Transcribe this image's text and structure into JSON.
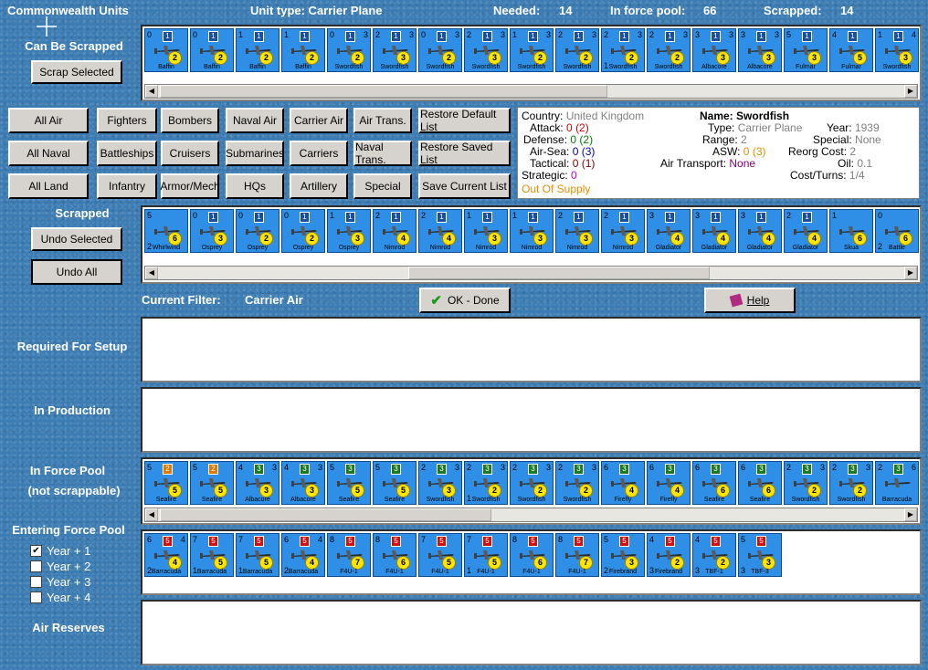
{
  "header": {
    "title": "Commonwealth Units",
    "unit_type": "Unit type: Carrier Plane",
    "needed_label": "Needed:",
    "needed_value": "14",
    "force_pool_label": "In force pool:",
    "force_pool_value": "66",
    "scrapped_label": "Scrapped:",
    "scrapped_value": "14"
  },
  "can_be_scrapped": {
    "label": "Can Be Scrapped",
    "button": "Scrap Selected",
    "units": [
      {
        "tl": "0",
        "flag": "1",
        "tr": "",
        "yc": "2",
        "name": "Baffin",
        "bl": ""
      },
      {
        "tl": "0",
        "flag": "1",
        "tr": "",
        "yc": "2",
        "name": "Baffin",
        "bl": ""
      },
      {
        "tl": "1",
        "flag": "1",
        "tr": "",
        "yc": "2",
        "name": "Baffin",
        "bl": ""
      },
      {
        "tl": "1",
        "flag": "1",
        "tr": "",
        "yc": "2",
        "name": "Baffin",
        "bl": ""
      },
      {
        "tl": "0",
        "flag": "1",
        "tr": "3",
        "yc": "2",
        "name": "Swordfish",
        "bl": ""
      },
      {
        "tl": "2",
        "flag": "1",
        "tr": "3",
        "yc": "3",
        "name": "Swordfish",
        "bl": ""
      },
      {
        "tl": "0",
        "flag": "1",
        "tr": "3",
        "yc": "2",
        "name": "Swordfish",
        "bl": ""
      },
      {
        "tl": "2",
        "flag": "1",
        "tr": "3",
        "yc": "3",
        "name": "Swordfish",
        "bl": ""
      },
      {
        "tl": "1",
        "flag": "1",
        "tr": "3",
        "yc": "2",
        "name": "Swordfish",
        "bl": ""
      },
      {
        "tl": "2",
        "flag": "1",
        "tr": "3",
        "yc": "2",
        "name": "Swordfish",
        "bl": ""
      },
      {
        "tl": "2",
        "flag": "1",
        "tr": "3",
        "yc": "2",
        "name": "Swordfish",
        "bl": "1"
      },
      {
        "tl": "2",
        "flag": "1",
        "tr": "3",
        "yc": "2",
        "name": "Swordfish",
        "bl": ""
      },
      {
        "tl": "3",
        "flag": "1",
        "tr": "3",
        "yc": "3",
        "name": "Albacore",
        "bl": ""
      },
      {
        "tl": "3",
        "flag": "1",
        "tr": "3",
        "yc": "3",
        "name": "Albacore",
        "bl": ""
      },
      {
        "tl": "5",
        "flag": "1",
        "tr": "",
        "yc": "3",
        "name": "Fulmar",
        "bl": ""
      },
      {
        "tl": "4",
        "flag": "1",
        "tr": "",
        "yc": "5",
        "name": "Fulmar",
        "bl": ""
      },
      {
        "tl": "1",
        "flag": "1",
        "tr": "4",
        "yc": "3",
        "name": "Swordfish",
        "bl": ""
      }
    ]
  },
  "filter_buttons": {
    "row1": [
      "All Air",
      "Fighters",
      "Bombers",
      "Naval Air",
      "Carrier Air",
      "Air Trans.",
      "Restore Default List"
    ],
    "row2": [
      "All Naval",
      "Battleships",
      "Cruisers",
      "Submarines",
      "Carriers",
      "Naval Trans.",
      "Restore Saved List"
    ],
    "row3": [
      "All Land",
      "Infantry",
      "Armor/Mech",
      "HQs",
      "Artillery",
      "Special",
      "Save Current List"
    ]
  },
  "info": {
    "country_label": "Country:",
    "country": "United Kingdom",
    "attack_label": "Attack:",
    "attack": "0",
    "attack_b": "(2)",
    "defense_label": "Defense:",
    "defense": "0",
    "defense_b": "(2)",
    "airsea_label": "Air-Sea:",
    "airsea": "0",
    "airsea_b": "(3)",
    "tactical_label": "Tactical:",
    "tactical": "0",
    "tactical_b": "(1)",
    "strategic_label": "Strategic:",
    "strategic": "0",
    "supply": "Out Of Supply",
    "name_label": "Name:",
    "name": "Swordfish",
    "type_label": "Type:",
    "type": "Carrier Plane",
    "year_label": "Year:",
    "year": "1939",
    "range_label": "Range:",
    "range": "2",
    "special_label": "Special:",
    "special": "None",
    "asw_label": "ASW:",
    "asw": "0",
    "asw_b": "(3)",
    "reorg_label": "Reorg Cost:",
    "reorg": "2",
    "airtrans_label": "Air Transport:",
    "airtrans": "None",
    "oil_label": "Oil:",
    "oil": "0.1",
    "cost_label": "Cost/Turns:",
    "cost": "1/4"
  },
  "scrapped": {
    "label": "Scrapped",
    "undo_selected": "Undo Selected",
    "undo_all": "Undo All",
    "units": [
      {
        "tl": "5",
        "flag": "",
        "tr": "",
        "yc": "6",
        "name": "Whirlwind",
        "bl": "2"
      },
      {
        "tl": "0",
        "flag": "1",
        "tr": "",
        "yc": "3",
        "name": "Osprey",
        "bl": ""
      },
      {
        "tl": "0",
        "flag": "1",
        "tr": "",
        "yc": "2",
        "name": "Osprey",
        "bl": ""
      },
      {
        "tl": "0",
        "flag": "1",
        "tr": "",
        "yc": "2",
        "name": "Osprey",
        "bl": ""
      },
      {
        "tl": "1",
        "flag": "1",
        "tr": "",
        "yc": "3",
        "name": "Osprey",
        "bl": ""
      },
      {
        "tl": "2",
        "flag": "1",
        "tr": "",
        "yc": "4",
        "name": "Nimrod",
        "bl": ""
      },
      {
        "tl": "2",
        "flag": "1",
        "tr": "",
        "yc": "4",
        "name": "Nimrod",
        "bl": ""
      },
      {
        "tl": "1",
        "flag": "1",
        "tr": "",
        "yc": "3",
        "name": "Nimrod",
        "bl": ""
      },
      {
        "tl": "1",
        "flag": "1",
        "tr": "",
        "yc": "3",
        "name": "Nimrod",
        "bl": ""
      },
      {
        "tl": "2",
        "flag": "1",
        "tr": "",
        "yc": "3",
        "name": "Nimrod",
        "bl": ""
      },
      {
        "tl": "2",
        "flag": "1",
        "tr": "",
        "yc": "3",
        "name": "Nimrod",
        "bl": ""
      },
      {
        "tl": "3",
        "flag": "1",
        "tr": "",
        "yc": "4",
        "name": "Gladiator",
        "bl": ""
      },
      {
        "tl": "3",
        "flag": "1",
        "tr": "",
        "yc": "4",
        "name": "Gladiator",
        "bl": ""
      },
      {
        "tl": "3",
        "flag": "1",
        "tr": "",
        "yc": "4",
        "name": "Gladiator",
        "bl": ""
      },
      {
        "tl": "2",
        "flag": "1",
        "tr": "",
        "yc": "4",
        "name": "Gladiator",
        "bl": ""
      },
      {
        "tl": "1",
        "flag": "",
        "tr": "",
        "yc": "6",
        "name": "Skua",
        "bl": ""
      },
      {
        "tl": "0",
        "flag": "",
        "tr": "",
        "yc": "6",
        "name": "Battle",
        "bl": "2"
      }
    ]
  },
  "filter": {
    "label": "Current Filter:",
    "value": "Carrier Air",
    "ok_button": "OK - Done",
    "help_button": "Help"
  },
  "required_for_setup": {
    "label": "Required For Setup"
  },
  "in_production": {
    "label": "In Production"
  },
  "in_force_pool": {
    "label_line1": "In Force Pool",
    "label_line2": "(not scrappable)",
    "units": [
      {
        "tl": "5",
        "flag": "2",
        "tr": "",
        "yc": "5",
        "name": "Seafire",
        "bl": ""
      },
      {
        "tl": "5",
        "flag": "2",
        "tr": "",
        "yc": "5",
        "name": "Seafire",
        "bl": ""
      },
      {
        "tl": "4",
        "flag": "3",
        "tr": "3",
        "yc": "3",
        "name": "Albacore",
        "bl": ""
      },
      {
        "tl": "4",
        "flag": "3",
        "tr": "3",
        "yc": "3",
        "name": "Albacore",
        "bl": ""
      },
      {
        "tl": "5",
        "flag": "3",
        "tr": "",
        "yc": "5",
        "name": "Seafire",
        "bl": ""
      },
      {
        "tl": "5",
        "flag": "3",
        "tr": "",
        "yc": "5",
        "name": "Seafire",
        "bl": ""
      },
      {
        "tl": "2",
        "flag": "3",
        "tr": "3",
        "yc": "3",
        "name": "Swordfish",
        "bl": ""
      },
      {
        "tl": "2",
        "flag": "3",
        "tr": "3",
        "yc": "2",
        "name": "Swordfish",
        "bl": "1"
      },
      {
        "tl": "2",
        "flag": "3",
        "tr": "3",
        "yc": "2",
        "name": "Swordfish",
        "bl": ""
      },
      {
        "tl": "2",
        "flag": "3",
        "tr": "3",
        "yc": "2",
        "name": "Swordfish",
        "bl": ""
      },
      {
        "tl": "6",
        "flag": "3",
        "tr": "",
        "yc": "4",
        "name": "Firefly",
        "bl": ""
      },
      {
        "tl": "6",
        "flag": "3",
        "tr": "",
        "yc": "4",
        "name": "Firefly",
        "bl": ""
      },
      {
        "tl": "6",
        "flag": "3",
        "tr": "",
        "yc": "6",
        "name": "Seafire",
        "bl": ""
      },
      {
        "tl": "6",
        "flag": "3",
        "tr": "",
        "yc": "6",
        "name": "Seafire",
        "bl": ""
      },
      {
        "tl": "2",
        "flag": "3",
        "tr": "3",
        "yc": "2",
        "name": "Swordfish",
        "bl": ""
      },
      {
        "tl": "2",
        "flag": "3",
        "tr": "3",
        "yc": "2",
        "name": "Swordfish",
        "bl": ""
      },
      {
        "tl": "2",
        "flag": "3",
        "tr": "6",
        "yc": "",
        "name": "Barracuda",
        "bl": ""
      }
    ]
  },
  "entering_force_pool": {
    "label": "Entering Force Pool",
    "options": [
      {
        "label": "Year + 1",
        "checked": true
      },
      {
        "label": "Year + 2",
        "checked": false
      },
      {
        "label": "Year + 3",
        "checked": false
      },
      {
        "label": "Year + 4",
        "checked": false
      }
    ],
    "units": [
      {
        "tl": "6",
        "flag": "5",
        "tr": "4",
        "yc": "4",
        "name": "Barracuda",
        "bl": "2"
      },
      {
        "tl": "7",
        "flag": "5",
        "tr": "",
        "yc": "5",
        "name": "Barracuda",
        "bl": "1"
      },
      {
        "tl": "7",
        "flag": "5",
        "tr": "",
        "yc": "5",
        "name": "Barracuda",
        "bl": "1"
      },
      {
        "tl": "6",
        "flag": "5",
        "tr": "4",
        "yc": "4",
        "name": "Barracuda",
        "bl": "2"
      },
      {
        "tl": "8",
        "flag": "5",
        "tr": "",
        "yc": "7",
        "name": "F4U-1",
        "bl": ""
      },
      {
        "tl": "8",
        "flag": "5",
        "tr": "",
        "yc": "6",
        "name": "F4U-1",
        "bl": ""
      },
      {
        "tl": "7",
        "flag": "5",
        "tr": "",
        "yc": "5",
        "name": "F4U-1",
        "bl": ""
      },
      {
        "tl": "7",
        "flag": "5",
        "tr": "",
        "yc": "5",
        "name": "F4U-1",
        "bl": "1"
      },
      {
        "tl": "8",
        "flag": "5",
        "tr": "",
        "yc": "6",
        "name": "F4U-1",
        "bl": ""
      },
      {
        "tl": "8",
        "flag": "5",
        "tr": "",
        "yc": "7",
        "name": "F4U-1",
        "bl": ""
      },
      {
        "tl": "5",
        "flag": "5",
        "tr": "",
        "yc": "3",
        "name": "Firebrand",
        "bl": "2"
      },
      {
        "tl": "4",
        "flag": "5",
        "tr": "",
        "yc": "2",
        "name": "Firebrand",
        "bl": "3"
      },
      {
        "tl": "4",
        "flag": "5",
        "tr": "",
        "yc": "2",
        "name": "TBF-1",
        "bl": "3"
      },
      {
        "tl": "5",
        "flag": "5",
        "tr": "",
        "yc": "3",
        "name": "TBF-3",
        "bl": "3"
      }
    ]
  },
  "air_reserves": {
    "label": "Air Reserves"
  },
  "colors": {
    "background": "#3c7cb3",
    "counter_blue": "#2f8fe6",
    "flag_1": "#1a4fa0",
    "flag_2": "#e07800",
    "flag_3": "#1a7a20",
    "flag_5": "#d01010"
  }
}
